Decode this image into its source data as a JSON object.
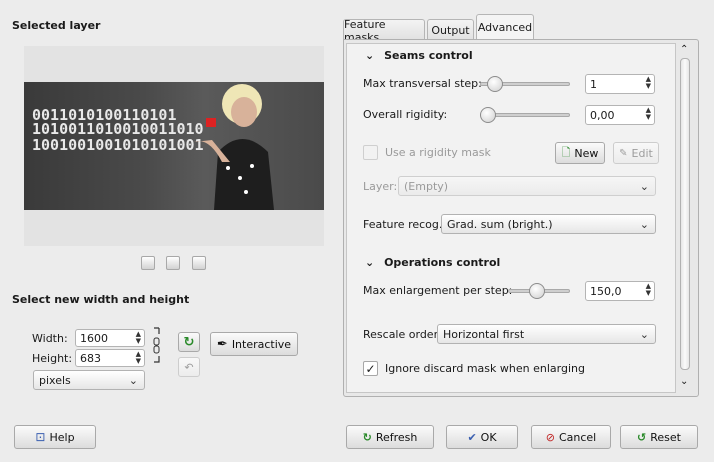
{
  "left": {
    "selected_layer_title": "Selected layer",
    "binary_rows": [
      "0011010100110101",
      "1010011010010011010",
      "1001001001010101001"
    ],
    "size_title": "Select new width and height",
    "width_label": "Width:",
    "width_value": "1600",
    "height_label": "Height:",
    "height_value": "683",
    "unit_value": "pixels",
    "interactive_label": "Interactive"
  },
  "tabs": [
    "Feature masks",
    "Output",
    "Advanced"
  ],
  "advanced": {
    "seams_title": "Seams control",
    "max_transversal_label": "Max transversal step:",
    "max_transversal_value": "1",
    "max_transversal_level": 0.1,
    "rigidity_label": "Overall rigidity:",
    "rigidity_value": "0,00",
    "rigidity_level": 0.0,
    "rigidity_mask_label": "Use a rigidity mask",
    "new_label": "New",
    "edit_label": "Edit",
    "layer_label": "Layer:",
    "layer_value": "(Empty)",
    "feature_label": "Feature recog.:",
    "feature_value": "Grad. sum (bright.)",
    "ops_title": "Operations control",
    "max_enlarge_label": "Max enlargement per step:",
    "max_enlarge_value": "150,0",
    "max_enlarge_level": 0.45,
    "rescale_label": "Rescale order:",
    "rescale_value": "Horizontal first",
    "ignore_label": "Ignore discard mask when enlarging"
  },
  "footer": {
    "help": "Help",
    "refresh": "Refresh",
    "ok": "OK",
    "cancel": "Cancel",
    "reset": "Reset"
  }
}
